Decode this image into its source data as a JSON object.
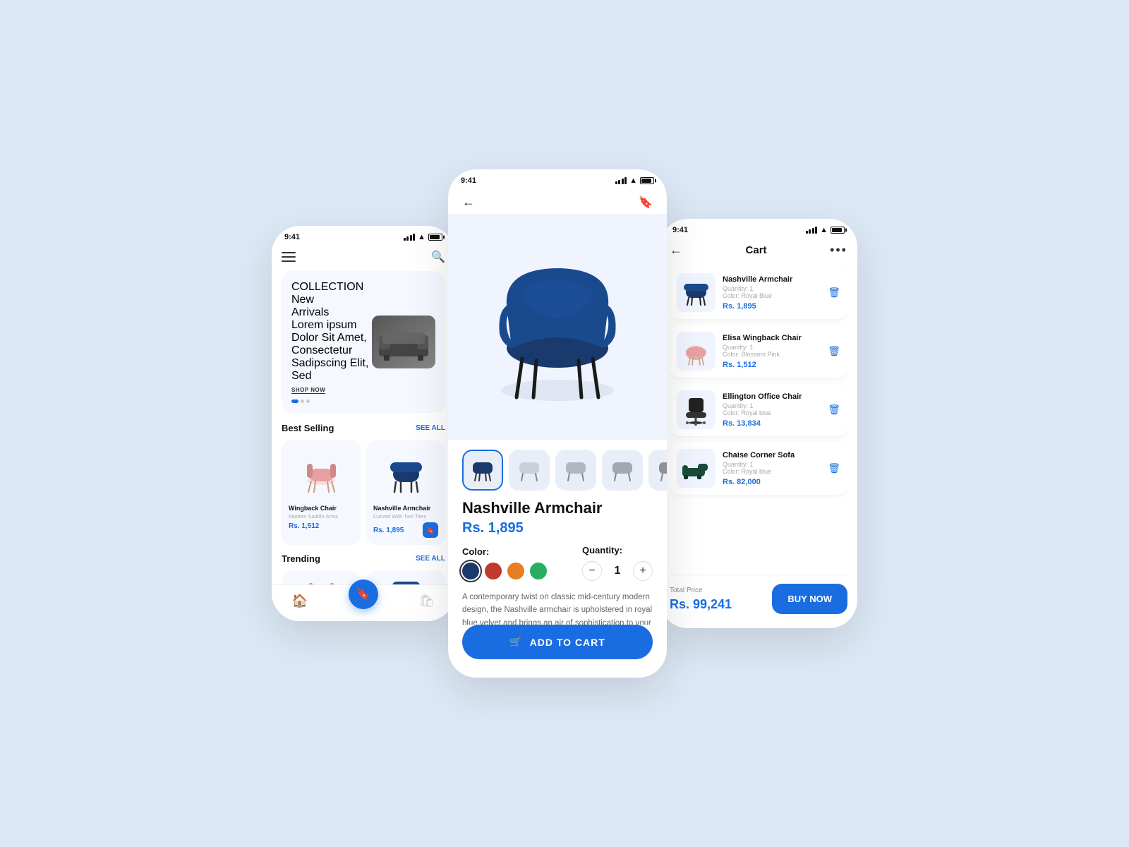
{
  "app": {
    "status_time": "9:41",
    "accent_color": "#1a6de0"
  },
  "left_phone": {
    "banner": {
      "collection_label": "COLLECTION",
      "title_blue": "New",
      "title_black": "Arrivals",
      "subtitle": "Lorem ipsum Dolor Sit Amet, Consectetur Sadipscing Elit, Sed",
      "shop_now": "SHOP NOW"
    },
    "best_selling": {
      "title": "Best Selling",
      "see_all": "SEE ALL",
      "products": [
        {
          "name": "Wingback Chair",
          "subtitle": "Modern Saddle Arms",
          "price": "Rs. 1,512",
          "color": "pink"
        },
        {
          "name": "Nashville Armchair",
          "subtitle": "Curved With Two Tiers",
          "price": "Rs. 1,895",
          "color": "navy"
        }
      ]
    },
    "trending": {
      "title": "Trending",
      "see_all": "SEE ALL"
    }
  },
  "center_phone": {
    "product": {
      "name": "Nashville Armchair",
      "price": "Rs. 1,895",
      "description": "A contemporary twist on classic mid-century modern design, the Nashville armchair is upholstered in royal blue velvet and brings an air of sophistication to your living space.",
      "color_label": "Color:",
      "quantity_label": "Quantity:",
      "quantity": 1,
      "colors": [
        "#1a3a6e",
        "#c0392b",
        "#e67e22",
        "#27ae60"
      ],
      "selected_color_index": 0,
      "add_to_cart": "ADD TO CART"
    }
  },
  "right_phone": {
    "header": {
      "title": "Cart",
      "more_icon": "•••"
    },
    "items": [
      {
        "name": "Nashville Armchair",
        "quantity": "Quantity: 1",
        "color": "Color: Royal Blue",
        "price": "Rs. 1,895",
        "color_bg": "#1a3a6e"
      },
      {
        "name": "Elisa Wingback Chair",
        "quantity": "Quantity: 1",
        "color": "Color: Blossom Pink",
        "price": "Rs. 1,512",
        "color_bg": "#e8b4b0"
      },
      {
        "name": "Ellington Office Chair",
        "quantity": "Quantity: 1",
        "color": "Color: Royal blue",
        "price": "Rs. 13,834",
        "color_bg": "#333"
      },
      {
        "name": "Chaise Corner Sofa",
        "quantity": "Quantity: 1",
        "color": "Color: Royal blue",
        "price": "Rs. 82,000",
        "color_bg": "#1a4a3a"
      }
    ],
    "total_label": "Total Price",
    "total_price": "Rs. 99,241",
    "buy_now": "BUY NOW"
  }
}
